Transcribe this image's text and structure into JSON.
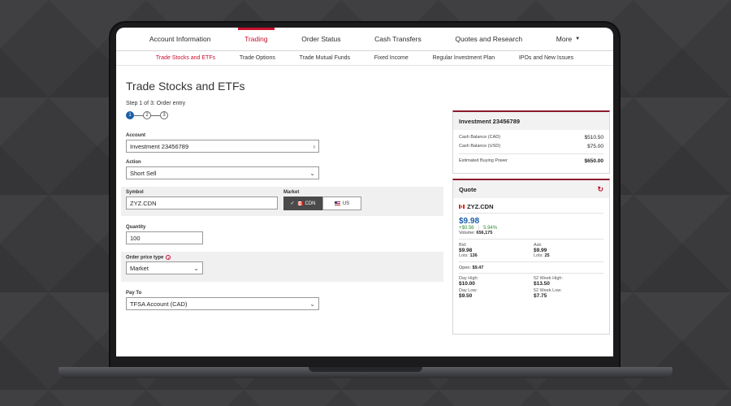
{
  "nav": {
    "tabs": [
      {
        "label": "Account Information"
      },
      {
        "label": "Trading"
      },
      {
        "label": "Order Status"
      },
      {
        "label": "Cash Transfers"
      },
      {
        "label": "Quotes and Research"
      },
      {
        "label": "More"
      }
    ],
    "active_tab": "Trading",
    "subtabs": [
      {
        "label": "Trade Stocks and ETFs"
      },
      {
        "label": "Trade Options"
      },
      {
        "label": "Trade Mutual Funds"
      },
      {
        "label": "Fixed Income"
      },
      {
        "label": "Regular Investment Plan"
      },
      {
        "label": "IPOs and New Issues"
      }
    ],
    "active_subtab": "Trade Stocks and ETFs"
  },
  "page": {
    "title": "Trade Stocks and ETFs",
    "step_text": "Step 1 of 3: Order entry",
    "steps": [
      "1",
      "2",
      "3"
    ],
    "current_step": 1
  },
  "form": {
    "account_label": "Account",
    "account_value": "Investment 23456789",
    "action_label": "Action",
    "action_value": "Short Sell",
    "symbol_label": "Symbol",
    "symbol_value": "ZYZ.CDN",
    "market_label": "Market",
    "market_options": [
      "CDN",
      "US"
    ],
    "market_selected": "CDN",
    "quantity_label": "Quantity",
    "quantity_value": "100",
    "price_type_label": "Order price type",
    "price_type_value": "Market",
    "pay_to_label": "Pay To",
    "pay_to_value": "TFSA Account (CAD)"
  },
  "account_panel": {
    "title": "Investment 23456789",
    "rows": [
      {
        "label": "Cash Balance (CAD)",
        "value": "$510.50"
      },
      {
        "label": "Cash Balance (USD)",
        "value": "$75.00"
      }
    ],
    "buying_power_label": "Estimated Buying Power",
    "buying_power_value": "$650.00"
  },
  "quote_panel": {
    "title": "Quote",
    "symbol": "ZYZ.CDN",
    "price": "$9.98",
    "change": "+$0.56",
    "change_pct": "5.94%",
    "volume_label": "Volume:",
    "volume_value": "656,175",
    "bid_label": "Bid:",
    "bid_value": "$9.98",
    "bid_lots_label": "Lots:",
    "bid_lots_value": "136",
    "ask_label": "Ask:",
    "ask_value": "$9.99",
    "ask_lots_label": "Lots:",
    "ask_lots_value": "25",
    "open_label": "Open:",
    "open_value": "$9.47",
    "day_high_label": "Day High:",
    "day_high_value": "$10.00",
    "week52_high_label": "52 Week High:",
    "week52_high_value": "$13.50",
    "day_low_label": "Day Low:",
    "day_low_value": "$9.50",
    "week52_low_label": "52 Week Low:",
    "week52_low_value": "$7.75"
  },
  "colors": {
    "accent": "#c8102e",
    "panel_border": "#8b1a2b",
    "step_active": "#1a5ea8",
    "price": "#1a5ea8",
    "gain": "#2e8b2e"
  }
}
